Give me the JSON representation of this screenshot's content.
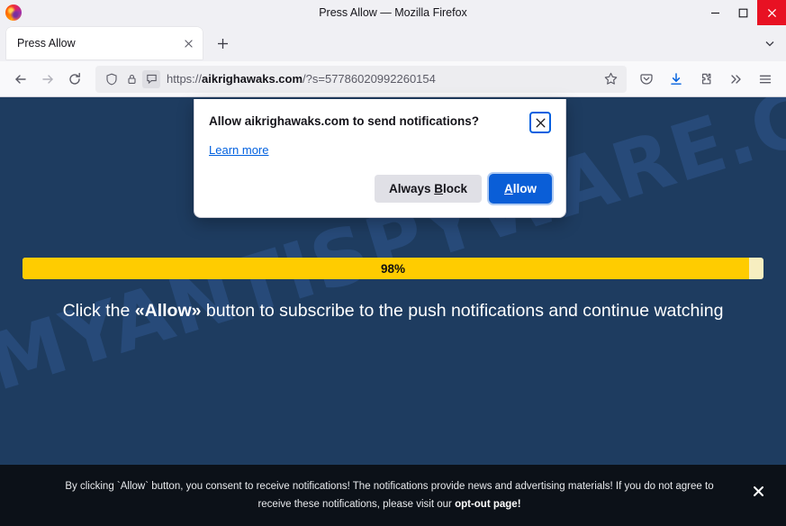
{
  "window": {
    "title": "Press Allow — Mozilla Firefox",
    "minimize_label": "Minimize",
    "maximize_label": "Maximize",
    "close_label": "Close"
  },
  "tabs": {
    "items": [
      {
        "title": "Press Allow",
        "close_label": "Close tab"
      }
    ],
    "new_tab_label": "Open a new tab",
    "list_all_tabs_label": "List all tabs"
  },
  "toolbar": {
    "back_label": "Go back one page",
    "forward_label": "Go forward one page",
    "reload_label": "Reload current page",
    "shield_label": "tracking-protection-shield",
    "lock_label": "connection-security",
    "notification_permission_label": "site-notification-permission",
    "url_scheme": "https://",
    "url_domain": "aikrighawaks.com",
    "url_path": "/?s=57786020992260154",
    "bookmark_label": "Bookmark this page",
    "pocket_label": "Save to Pocket",
    "downloads_label": "Downloads",
    "extensions_label": "Extensions",
    "overflow_label": "More tools",
    "menu_label": "Open application menu"
  },
  "permission_dialog": {
    "title": "Allow aikrighawaks.com to send notifications?",
    "learn_more": "Learn more",
    "close_label": "Close",
    "block_button": {
      "prefix": "Always ",
      "accesskey": "B",
      "suffix": "lock"
    },
    "allow_button": {
      "prefix": "",
      "accesskey": "A",
      "suffix": "llow"
    }
  },
  "page": {
    "watermark": "MYANTISPYWARE.COM",
    "progress": {
      "percent": 98,
      "label": "98%",
      "fill_color": "#ffcc00",
      "track_color": "#f7eec0"
    },
    "headline": {
      "before": "Click the ",
      "emphasis": "«Allow»",
      "after": " button to subscribe to the push notifications and continue watching"
    },
    "background_color": "#1e3c60"
  },
  "consent_banner": {
    "line1_before": "By clicking `Allow` button, you consent to receive notifications! The notifications provide news and advertising materials! If you do not agree to",
    "line2_before": "receive these notifications, please visit our ",
    "line2_link": "opt-out page!",
    "close_label": "Close banner",
    "background_color": "#0c1118"
  }
}
